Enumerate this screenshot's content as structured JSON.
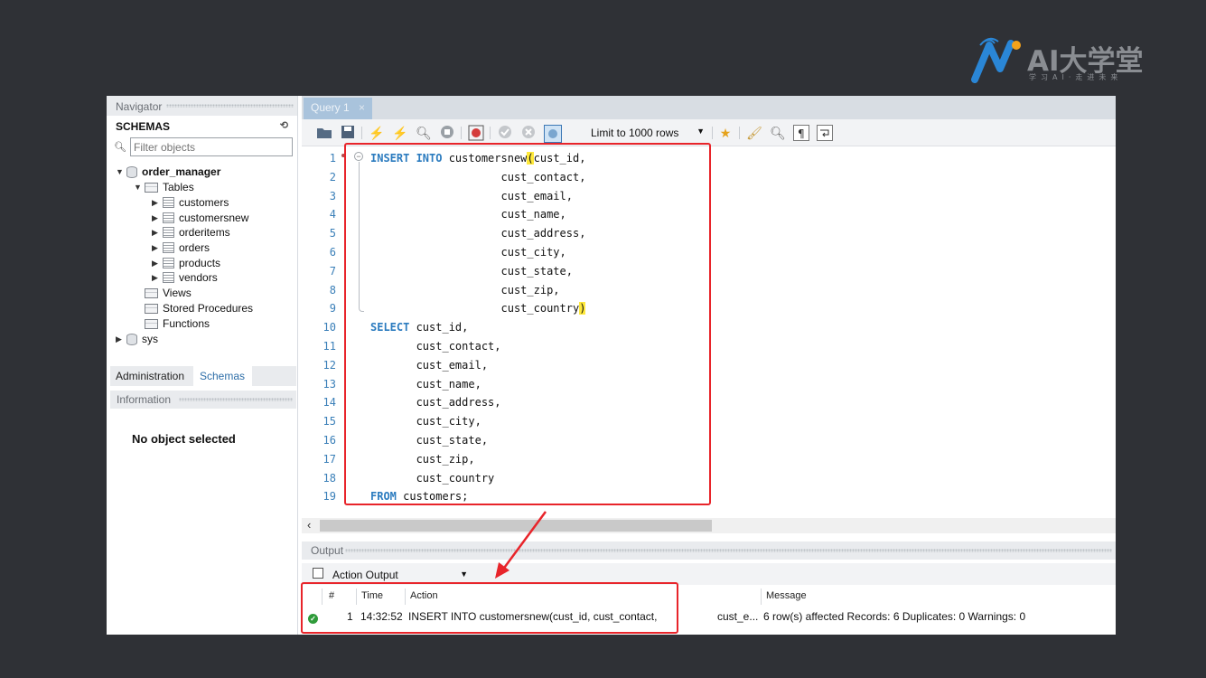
{
  "logo": {
    "main": "AI大学堂",
    "sub": "学习AI·走进未来"
  },
  "navigator": {
    "title": "Navigator",
    "schemas_label": "SCHEMAS",
    "filter_placeholder": "Filter objects",
    "tree": {
      "db": "order_manager",
      "tables_label": "Tables",
      "tables": [
        "customers",
        "customersnew",
        "orderitems",
        "orders",
        "products",
        "vendors"
      ],
      "views": "Views",
      "procs": "Stored Procedures",
      "funcs": "Functions",
      "sys": "sys"
    },
    "tab_admin": "Administration",
    "tab_schemas": "Schemas",
    "info_title": "Information",
    "no_object": "No object selected"
  },
  "query_tab": {
    "label": "Query 1",
    "close": "×"
  },
  "toolbar": {
    "limit": "Limit to 1000 rows"
  },
  "editor": {
    "lines": [
      {
        "n": "1",
        "kw": "INSERT INTO",
        "rest": " customersnew",
        "paren": "(",
        "tail": "cust_id,"
      },
      {
        "n": "2",
        "text": "                    cust_contact,"
      },
      {
        "n": "3",
        "text": "                    cust_email,"
      },
      {
        "n": "4",
        "text": "                    cust_name,"
      },
      {
        "n": "5",
        "text": "                    cust_address,"
      },
      {
        "n": "6",
        "text": "                    cust_city,"
      },
      {
        "n": "7",
        "text": "                    cust_state,"
      },
      {
        "n": "8",
        "text": "                    cust_zip,"
      },
      {
        "n": "9",
        "text": "                    cust_country",
        "paren_end": ")"
      },
      {
        "n": "10",
        "kw": "SELECT",
        "tail": " cust_id,"
      },
      {
        "n": "11",
        "text": "       cust_contact,"
      },
      {
        "n": "12",
        "text": "       cust_email,"
      },
      {
        "n": "13",
        "text": "       cust_name,"
      },
      {
        "n": "14",
        "text": "       cust_address,"
      },
      {
        "n": "15",
        "text": "       cust_city,"
      },
      {
        "n": "16",
        "text": "       cust_state,"
      },
      {
        "n": "17",
        "text": "       cust_zip,"
      },
      {
        "n": "18",
        "text": "       cust_country"
      },
      {
        "n": "19",
        "kw": "FROM",
        "tail": " customers;"
      }
    ]
  },
  "output": {
    "title": "Output",
    "selector": "Action Output",
    "headers": {
      "num": "#",
      "time": "Time",
      "action": "Action",
      "message": "Message"
    },
    "row": {
      "num": "1",
      "time": "14:32:52",
      "action": "INSERT INTO customersnew(cust_id,    cust_contact,",
      "action_tail": "cust_e...",
      "message": "6 row(s) affected Records: 6  Duplicates: 0  Warnings: 0"
    }
  },
  "colors": {
    "annotation": "#e8242a",
    "keyword": "#2b7bbf",
    "logo": "#2a86d6"
  }
}
